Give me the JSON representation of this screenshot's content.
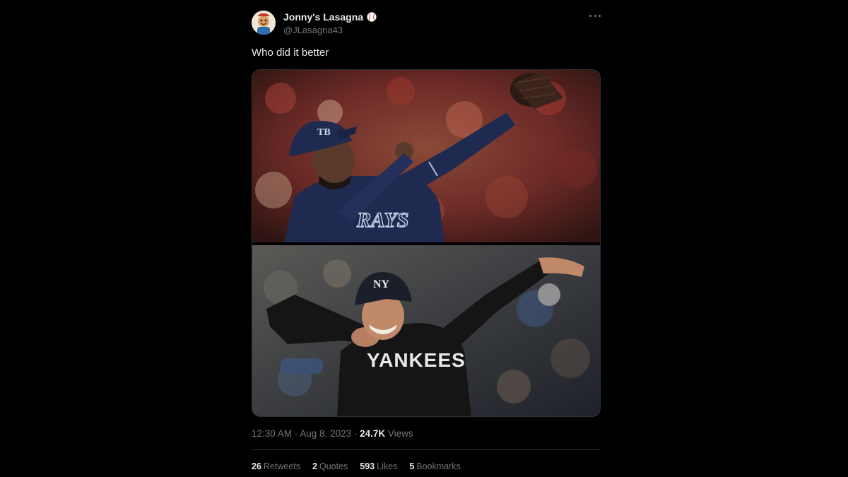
{
  "author": {
    "display_name": "Jonny's Lasagna",
    "handle": "@JLasagna43",
    "badge_icon": "baseball-icon",
    "more_icon": "more-options-icon"
  },
  "tweet": {
    "text": "Who did it better",
    "timestamp": "12:30 AM · Aug 8, 2023 · ",
    "views_count": "24.7K",
    "views_label": " Views"
  },
  "media": {
    "photos": [
      {
        "cap_letters": "TB",
        "jersey_text": "RAYS"
      },
      {
        "cap_letters": "NY",
        "jersey_text": "YANKEES"
      }
    ]
  },
  "stats": [
    {
      "count": "26",
      "label": "Retweets"
    },
    {
      "count": "2",
      "label": "Quotes"
    },
    {
      "count": "593",
      "label": "Likes"
    },
    {
      "count": "5",
      "label": "Bookmarks"
    }
  ],
  "colors": {
    "background": "#000000",
    "primary_text": "#e7e9ea",
    "secondary_text": "#71767b",
    "divider": "#2f3336",
    "rays_navy": "#1f2a50",
    "yankees_black": "#151515"
  }
}
